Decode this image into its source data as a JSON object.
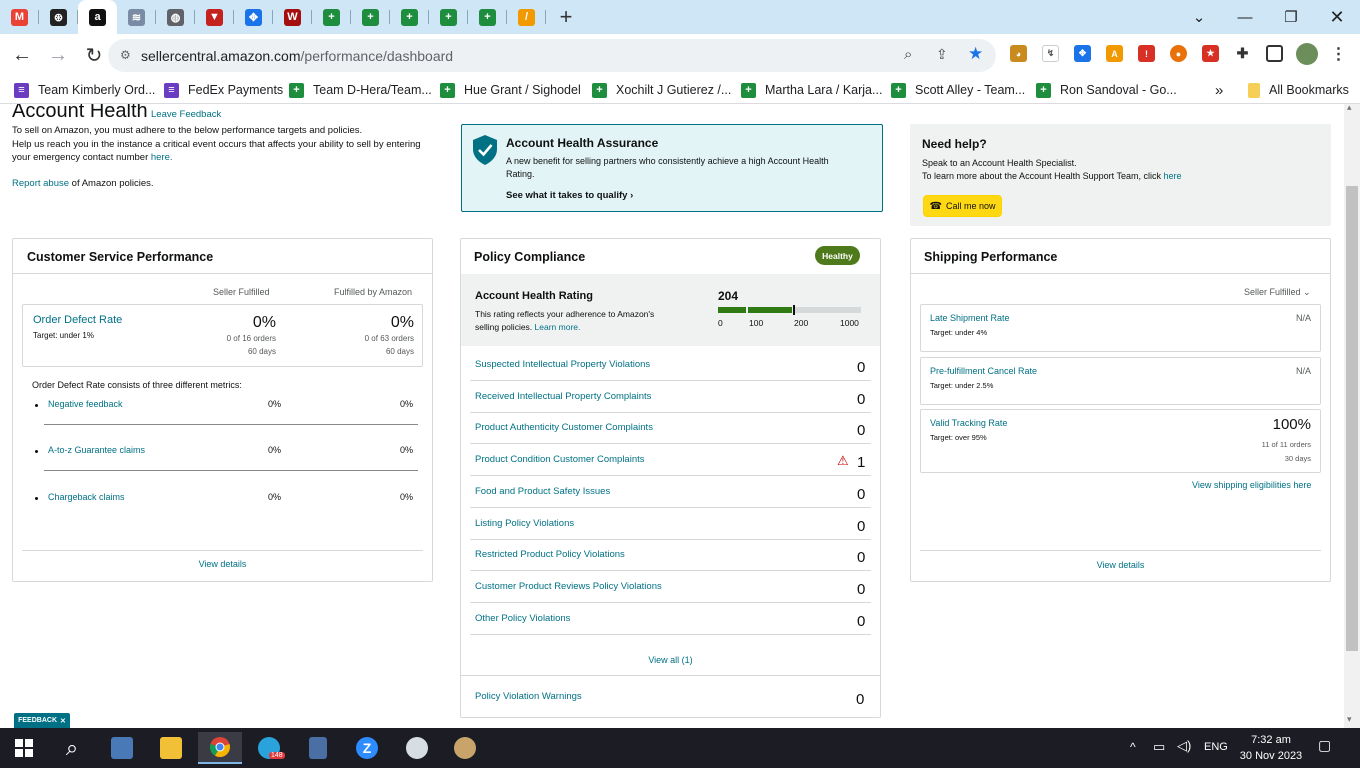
{
  "browser": {
    "tabs": [
      {
        "icon": "gmail-icon",
        "color": "#ea4335",
        "glyph": "M"
      },
      {
        "icon": "chatgpt-icon",
        "color": "#222222",
        "glyph": "⊛"
      },
      {
        "icon": "amazon-icon",
        "color": "#111111",
        "glyph": "a",
        "active": true
      },
      {
        "icon": "page-icon",
        "color": "#7a8ca5",
        "glyph": "≋"
      },
      {
        "icon": "globe-icon",
        "color": "#5f6368",
        "glyph": "◍"
      },
      {
        "icon": "triangle-logo-icon",
        "color": "#c5221f",
        "glyph": "▼"
      },
      {
        "icon": "wheel-icon",
        "color": "#1a73e8",
        "glyph": "✥"
      },
      {
        "icon": "w-logo-icon",
        "color": "#a50e0e",
        "glyph": "W"
      },
      {
        "icon": "sheets-icon",
        "color": "#1e8e3e",
        "glyph": "+"
      },
      {
        "icon": "sheets-icon",
        "color": "#1e8e3e",
        "glyph": "+"
      },
      {
        "icon": "sheets-icon",
        "color": "#1e8e3e",
        "glyph": "+"
      },
      {
        "icon": "sheets-icon",
        "color": "#1e8e3e",
        "glyph": "+"
      },
      {
        "icon": "sheets-icon",
        "color": "#1e8e3e",
        "glyph": "+"
      },
      {
        "icon": "slides-icon",
        "color": "#f29900",
        "glyph": "/"
      }
    ],
    "url_host": "sellercentral.amazon.com",
    "url_path": "/performance/dashboard",
    "bookmarks": [
      {
        "label": "Team Kimberly Ord...",
        "icon": "forms-icon"
      },
      {
        "label": "FedEx Payments",
        "icon": "forms-icon"
      },
      {
        "label": "Team D-Hera/Team...",
        "icon": "sheets-icon"
      },
      {
        "label": "Hue Grant / Sighodel",
        "icon": "sheets-icon"
      },
      {
        "label": "Xochilt J Gutierez /...",
        "icon": "sheets-icon"
      },
      {
        "label": "Martha Lara / Karja...",
        "icon": "sheets-icon"
      },
      {
        "label": "Scott Alley - Team...",
        "icon": "sheets-icon"
      },
      {
        "label": "Ron Sandoval - Go...",
        "icon": "sheets-icon"
      }
    ],
    "all_bookmarks": "All Bookmarks",
    "overflow": "»"
  },
  "header": {
    "title": "Account Health",
    "leave_feedback": "Leave Feedback",
    "line1": "To sell on Amazon, you must adhere to the below performance targets and policies.",
    "line2": "Help us reach you in the instance a critical event occurs that affects your ability to sell by entering",
    "line3_pre": "your emergency contact number ",
    "line3_link": "here.",
    "report_link": "Report abuse",
    "report_rest": " of Amazon policies."
  },
  "assurance": {
    "title": "Account Health Assurance",
    "desc1": "A new benefit for selling partners who consistently achieve a high Account Health",
    "desc2": "Rating.",
    "cta": "See what it takes to qualify"
  },
  "help": {
    "title": "Need help?",
    "line1": "Speak to an Account Health Specialist.",
    "line2": "To learn more about the Account Health Support Team, click ",
    "line2_link": "here",
    "call_button": "Call me now"
  },
  "customer_service": {
    "title": "Customer Service Performance",
    "col1": "Seller Fulfilled",
    "col2": "Fulfilled by Amazon",
    "odr_label": "Order Defect Rate",
    "odr_target": "Target: under 1%",
    "sf_value": "0%",
    "sf_orders": "0 of 16 orders",
    "sf_days": "60 days",
    "fba_value": "0%",
    "fba_orders": "0 of 63 orders",
    "fba_days": "60 days",
    "metrics_intro": "Order Defect Rate consists of three different metrics:",
    "metrics": [
      {
        "label": "Negative feedback",
        "sf": "0%",
        "fba": "0%"
      },
      {
        "label": "A-to-z Guarantee claims",
        "sf": "0%",
        "fba": "0%"
      },
      {
        "label": "Chargeback claims",
        "sf": "0%",
        "fba": "0%"
      }
    ],
    "view_details": "View details"
  },
  "policy": {
    "title": "Policy Compliance",
    "badge": "Healthy",
    "ahr_title": "Account Health Rating",
    "ahr_desc1": "This rating reflects your adherence to Amazon's",
    "ahr_desc2": "selling policies. ",
    "ahr_learn": "Learn more.",
    "rating": "204",
    "rating_value": 204,
    "scale": [
      "0",
      "100",
      "200",
      "1000"
    ],
    "rows": [
      {
        "label": "Suspected Intellectual Property Violations",
        "count": "0"
      },
      {
        "label": "Received Intellectual Property Complaints",
        "count": "0"
      },
      {
        "label": "Product Authenticity Customer Complaints",
        "count": "0"
      },
      {
        "label": "Product Condition Customer Complaints",
        "count": "1",
        "warn": true
      },
      {
        "label": "Food and Product Safety Issues",
        "count": "0"
      },
      {
        "label": "Listing Policy Violations",
        "count": "0"
      },
      {
        "label": "Restricted Product Policy Violations",
        "count": "0"
      },
      {
        "label": "Customer Product Reviews Policy Violations",
        "count": "0"
      },
      {
        "label": "Other Policy Violations",
        "count": "0"
      }
    ],
    "view_all": "View all (1)",
    "warnings_label": "Policy Violation Warnings",
    "warnings_count": "0"
  },
  "shipping": {
    "title": "Shipping Performance",
    "filter": "Seller Fulfilled",
    "metrics": [
      {
        "label": "Late Shipment Rate",
        "target": "Target: under 4%",
        "value": "N/A"
      },
      {
        "label": "Pre-fulfillment Cancel Rate",
        "target": "Target: under 2.5%",
        "value": "N/A"
      },
      {
        "label": "Valid Tracking Rate",
        "target": "Target: over 95%",
        "value": "100%",
        "orders": "11 of 11 orders",
        "days": "30 days"
      }
    ],
    "eligibility_link": "View shipping eligibilities here",
    "view_details": "View details"
  },
  "feedback_tab": "FEEDBACK",
  "taskbar": {
    "lang": "ENG",
    "time": "7:32 am",
    "date": "30 Nov 2023",
    "telegram_badge": "148"
  }
}
